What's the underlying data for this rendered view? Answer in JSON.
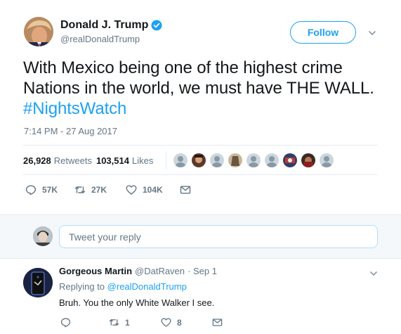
{
  "tweet": {
    "author_name": "Donald J. Trump",
    "author_handle": "@realDonaldTrump",
    "follow_label": "Follow",
    "text_main": "With Mexico being one of the highest crime Nations in the world, we must have THE WALL.",
    "hashtag": "#NightsWatch",
    "timestamp": "7:14 PM - 27 Aug 2017",
    "retweets_count": "26,928",
    "retweets_label": "Retweets",
    "likes_count": "103,514",
    "likes_label": "Likes",
    "actions": {
      "replies": "57K",
      "retweets": "27K",
      "likes": "104K"
    }
  },
  "reply_composer": {
    "placeholder": "Tweet your reply"
  },
  "reply": {
    "name": "Gorgeous Martin",
    "handle": "@DatRaven",
    "date": "· Sep 1",
    "replying_prefix": "Replying to",
    "replying_to": "@realDonaldTrump",
    "text": "Bruh. You the only White Walker I see.",
    "actions": {
      "retweets": "1",
      "likes": "8"
    }
  },
  "colors": {
    "accent": "#1da1f2",
    "text": "#14171a",
    "muted": "#657786",
    "border": "#e6ecf0",
    "background_alt": "#f5f8fa"
  },
  "icons": [
    "verified-badge-icon",
    "chevron-down-icon",
    "reply-icon",
    "retweet-icon",
    "heart-icon",
    "envelope-icon"
  ]
}
